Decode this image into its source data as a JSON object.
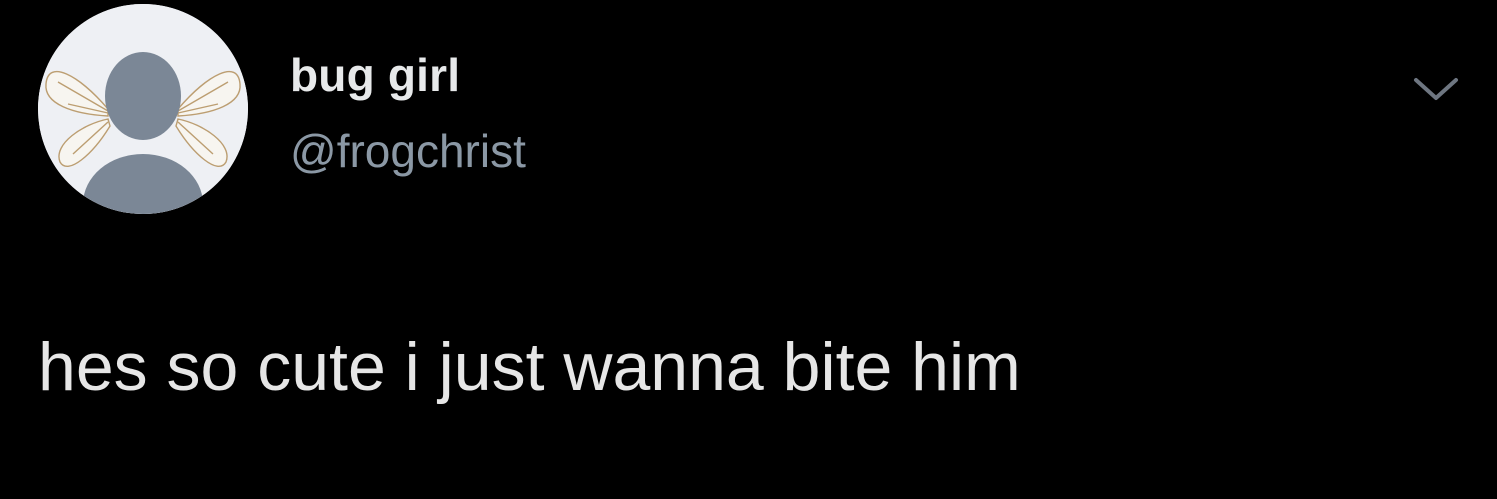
{
  "tweet": {
    "author": {
      "display_name": "bug girl",
      "handle": "@frogchrist",
      "avatar_icon": "default-avatar-with-fairy-wings-icon"
    },
    "text": "hes so cute i just wanna bite him",
    "menu_icon": "chevron-down-icon"
  },
  "colors": {
    "background": "#000000",
    "display_name": "#e7e9ea",
    "handle": "#8b98a5",
    "text": "#e6e6e6",
    "chevron": "#6e7681",
    "avatar_bg": "#eef0f4",
    "avatar_figure": "#7b8796"
  }
}
